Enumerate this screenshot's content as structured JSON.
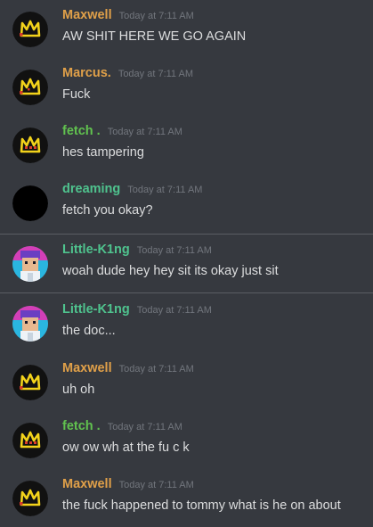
{
  "colors": {
    "background": "#36393f",
    "text": "#dcddde",
    "timestamp": "#72767d",
    "name_orange": "#e0a049",
    "name_green": "#61c24f",
    "name_teal": "#4fc38e"
  },
  "messages": [
    {
      "author": "Maxwell",
      "time": "Today at 7:11 AM",
      "text": "AW SHIT HERE WE GO AGAIN",
      "name_color": "#e0a049",
      "avatar": "crown-yellow-icon"
    },
    {
      "author": "Marcus.",
      "time": "Today at 7:11 AM",
      "text": "Fuck",
      "name_color": "#e0a049",
      "avatar": "crown-yellow-icon"
    },
    {
      "author": "fetch .",
      "time": "Today at 7:11 AM",
      "text": "hes tampering",
      "name_color": "#61c24f",
      "avatar": "crown-red-eyes-icon"
    },
    {
      "author": "dreaming",
      "time": "Today at 7:11 AM",
      "text": "fetch you okay?",
      "name_color": "#4fc38e",
      "avatar": "black-circle-avatar"
    },
    {
      "author": "Little-K1ng",
      "time": "Today at 7:11 AM",
      "text": "woah dude hey hey sit its okay just sit",
      "name_color": "#4fc38e",
      "avatar": "pixel-character-avatar"
    },
    {
      "author": "Little-K1ng",
      "time": "Today at 7:11 AM",
      "text": "the doc...",
      "name_color": "#4fc38e",
      "avatar": "pixel-character-avatar"
    },
    {
      "author": "Maxwell",
      "time": "Today at 7:11 AM",
      "text": "uh oh",
      "name_color": "#e0a049",
      "avatar": "crown-yellow-icon"
    },
    {
      "author": "fetch .",
      "time": "Today at 7:11 AM",
      "text": "ow ow wh at the fu c k",
      "name_color": "#61c24f",
      "avatar": "crown-red-eyes-icon"
    },
    {
      "author": "Maxwell",
      "time": "Today at 7:11 AM",
      "text": "the fuck happened to tommy what is he on about",
      "name_color": "#e0a049",
      "avatar": "crown-yellow-icon"
    }
  ]
}
